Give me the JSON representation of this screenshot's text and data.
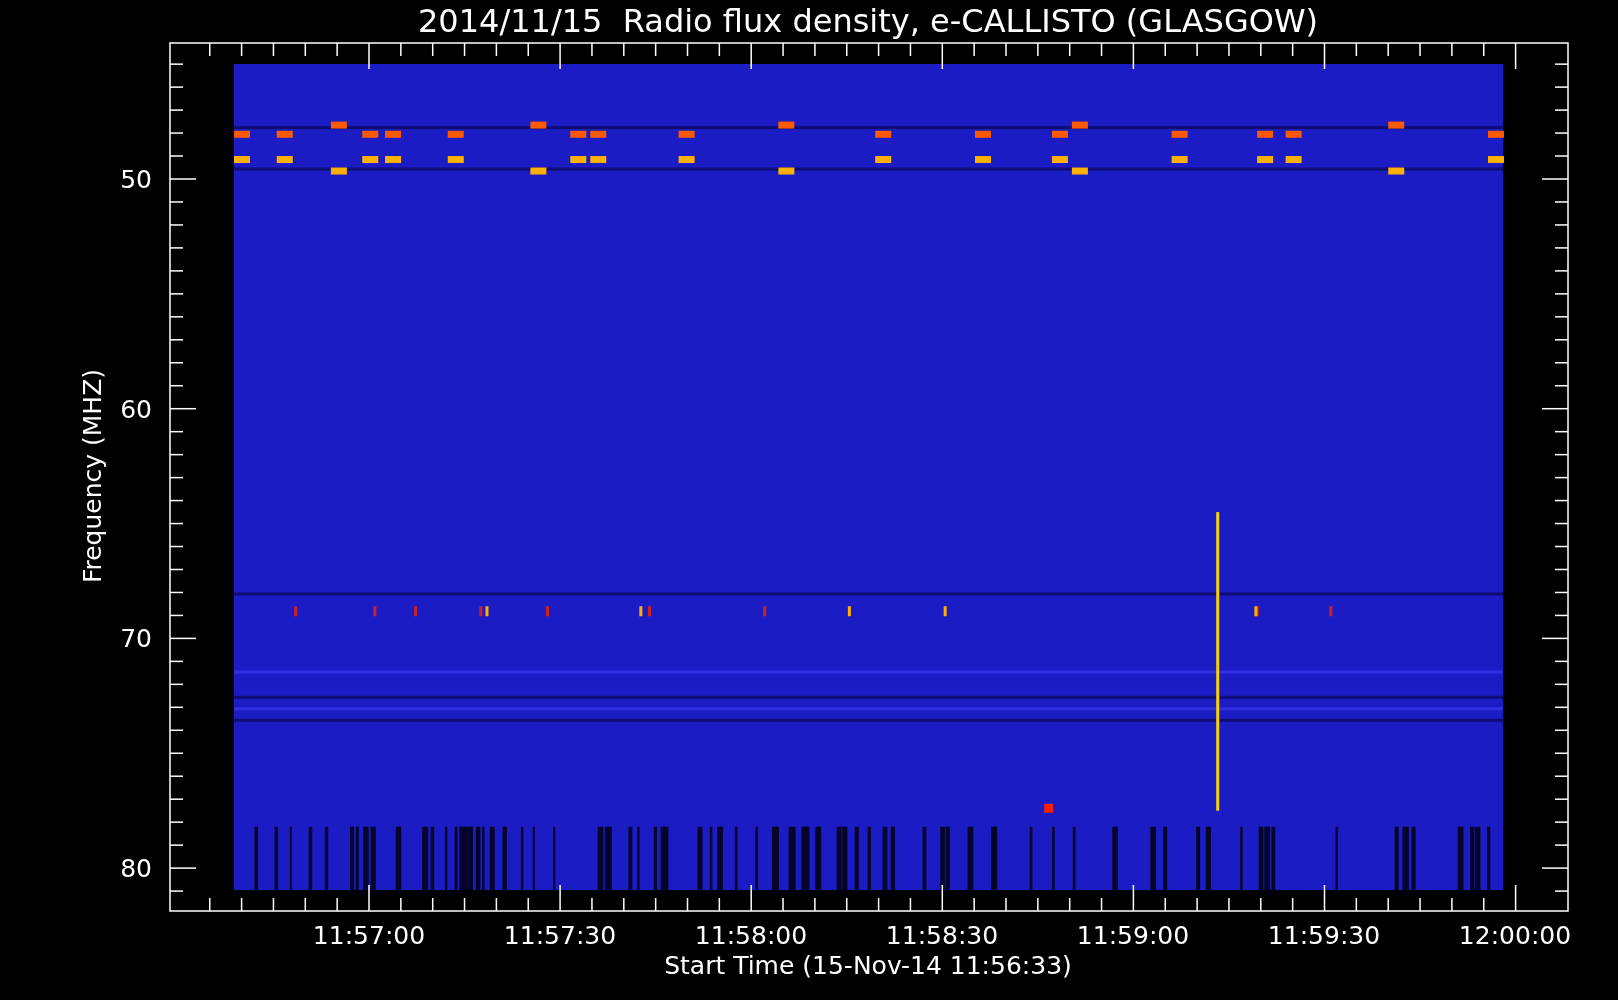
{
  "title": "2014/11/15  Radio flux density, e-CALLISTO (GLASGOW)",
  "ylabel": "Frequency (MHZ)",
  "xlabel": "Start Time (15-Nov-14 11:56:33)",
  "yticks": [
    {
      "label": "50"
    },
    {
      "label": "60"
    },
    {
      "label": "70"
    },
    {
      "label": "80"
    }
  ],
  "xticks": [
    {
      "label": "11:57:00"
    },
    {
      "label": "11:57:30"
    },
    {
      "label": "11:58:00"
    },
    {
      "label": "11:58:30"
    },
    {
      "label": "11:59:00"
    },
    {
      "label": "11:59:30"
    },
    {
      "label": "12:00:00"
    }
  ]
}
